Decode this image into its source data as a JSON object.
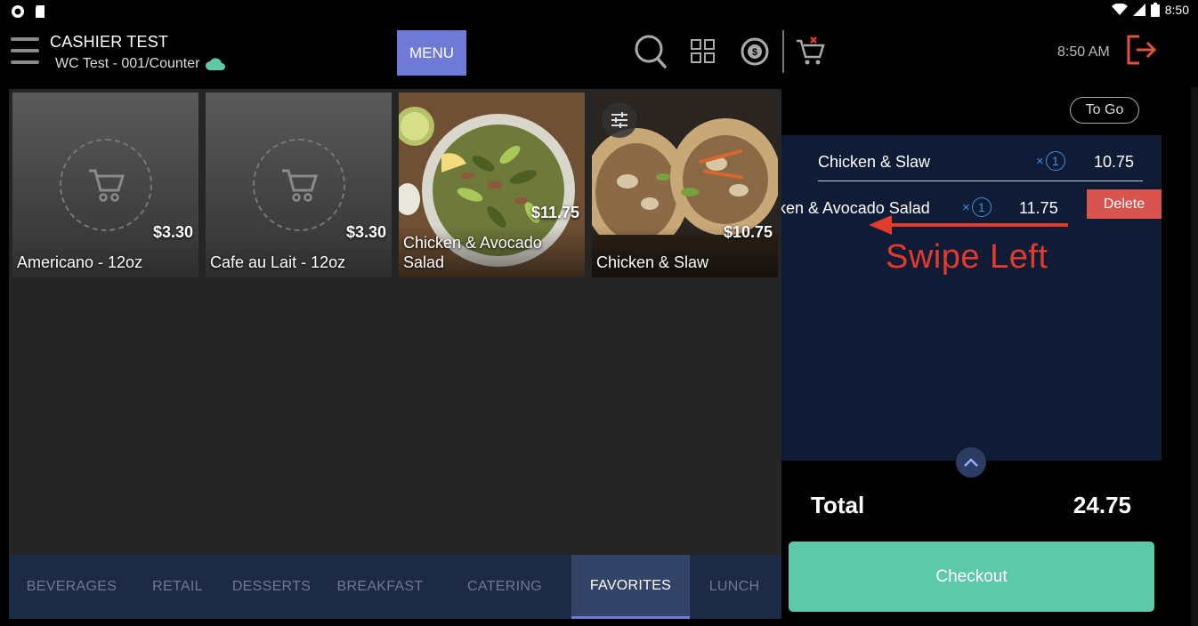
{
  "status_bar": {
    "time": "8:50"
  },
  "header": {
    "cashier": "CASHIER TEST",
    "station": "WC Test - 001/Counter",
    "menu_label": "MENU",
    "time": "8:50 AM"
  },
  "products": [
    {
      "name": "Americano - 12oz",
      "price": "$3.30",
      "image": "placeholder-cart"
    },
    {
      "name": "Cafe au Lait - 12oz",
      "price": "$3.30",
      "image": "placeholder-cart"
    },
    {
      "name": "Chicken & Avocado Salad",
      "price": "$11.75",
      "image": "salad-photo"
    },
    {
      "name": "Chicken & Slaw",
      "price": "$10.75",
      "image": "sandwich-photo",
      "has_modifiers_icon": true
    }
  ],
  "categories": [
    {
      "label": "BEVERAGES",
      "active": false
    },
    {
      "label": "RETAIL",
      "active": false
    },
    {
      "label": "DESSERTS",
      "active": false
    },
    {
      "label": "BREAKFAST",
      "active": false
    },
    {
      "label": "CATERING",
      "active": false
    },
    {
      "label": "FAVORITES",
      "active": true
    },
    {
      "label": "LUNCH",
      "active": false
    }
  ],
  "order": {
    "type_label": "To Go",
    "lines": [
      {
        "name": "Chicken & Slaw",
        "qty_prefix": "×",
        "qty": "1",
        "price": "10.75"
      },
      {
        "name": "ken & Avocado Salad",
        "qty_prefix": "×",
        "qty": "1",
        "price": "11.75"
      }
    ],
    "delete_label": "Delete",
    "annotation": "Swipe Left",
    "total_label": "Total",
    "total_value": "24.75",
    "checkout_label": "Checkout"
  },
  "colors": {
    "menu_button": "#6f79d6",
    "checkout": "#5dc9a8",
    "delete": "#d9534f",
    "annotation": "#e23a2c",
    "order_panel": "#101c36",
    "tabs_bg": "#1d2a45"
  }
}
